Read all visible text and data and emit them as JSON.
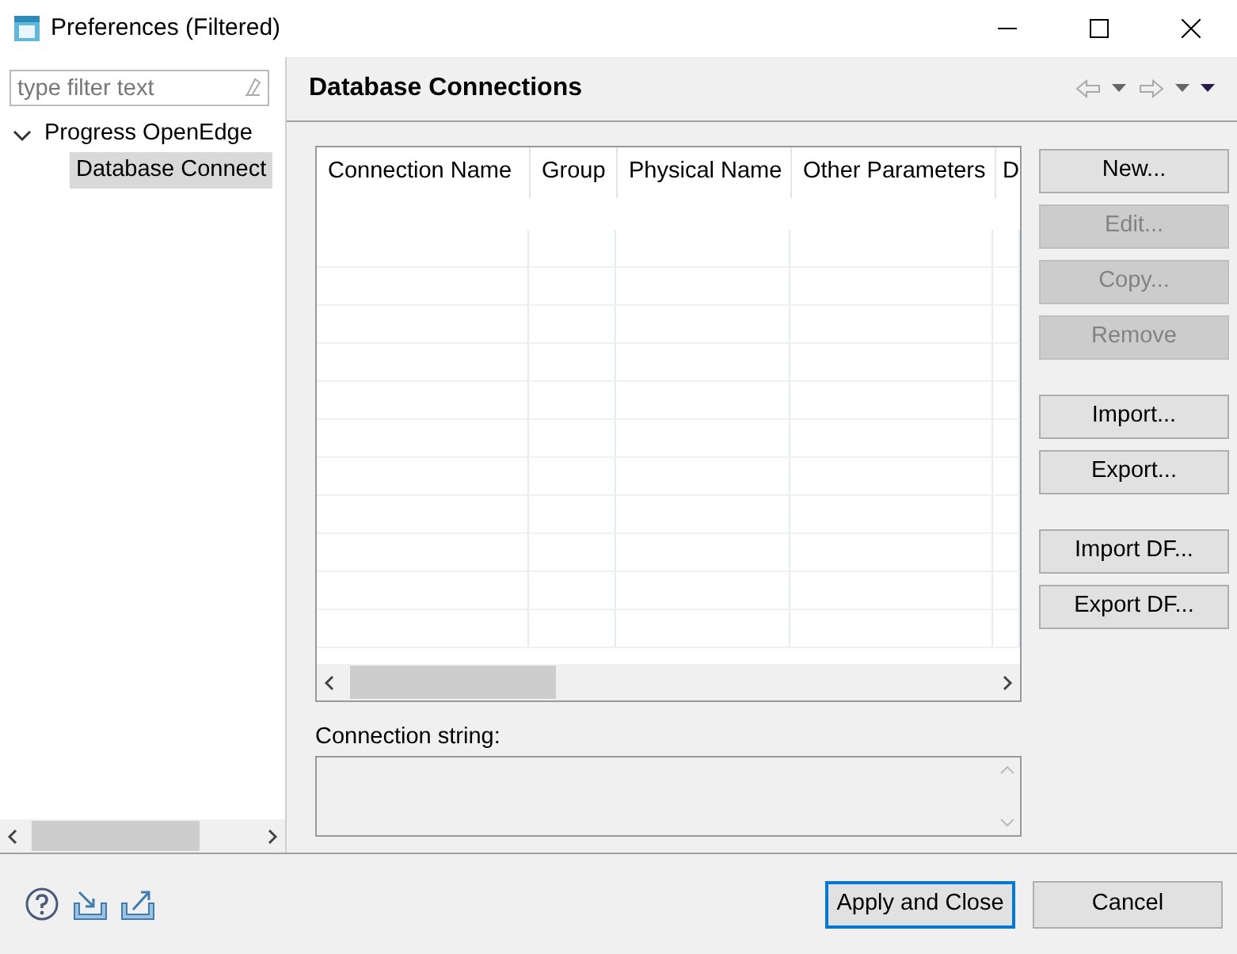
{
  "window": {
    "title": "Preferences (Filtered)"
  },
  "filter": {
    "placeholder": "type filter text"
  },
  "tree": [
    {
      "label": "Progress OpenEdge",
      "expanded": true,
      "selected": false,
      "children": [
        {
          "label": "Database Connect",
          "selected": true
        }
      ]
    }
  ],
  "page": {
    "title": "Database Connections"
  },
  "table": {
    "columns": [
      "Connection Name",
      "Group",
      "Physical Name",
      "Other Parameters",
      "D"
    ]
  },
  "side_button_groups": [
    [
      {
        "label": "New...",
        "disabled": false
      },
      {
        "label": "Edit...",
        "disabled": true
      },
      {
        "label": "Copy...",
        "disabled": true
      },
      {
        "label": "Remove",
        "disabled": true
      }
    ],
    [
      {
        "label": "Import...",
        "disabled": false
      },
      {
        "label": "Export...",
        "disabled": false
      }
    ],
    [
      {
        "label": "Import DF...",
        "disabled": false
      },
      {
        "label": "Export DF...",
        "disabled": false
      }
    ]
  ],
  "connection_string": {
    "label": "Connection string:"
  },
  "footer_buttons": [
    {
      "label": "Apply and Close",
      "default": true
    },
    {
      "label": "Cancel",
      "default": false
    }
  ]
}
